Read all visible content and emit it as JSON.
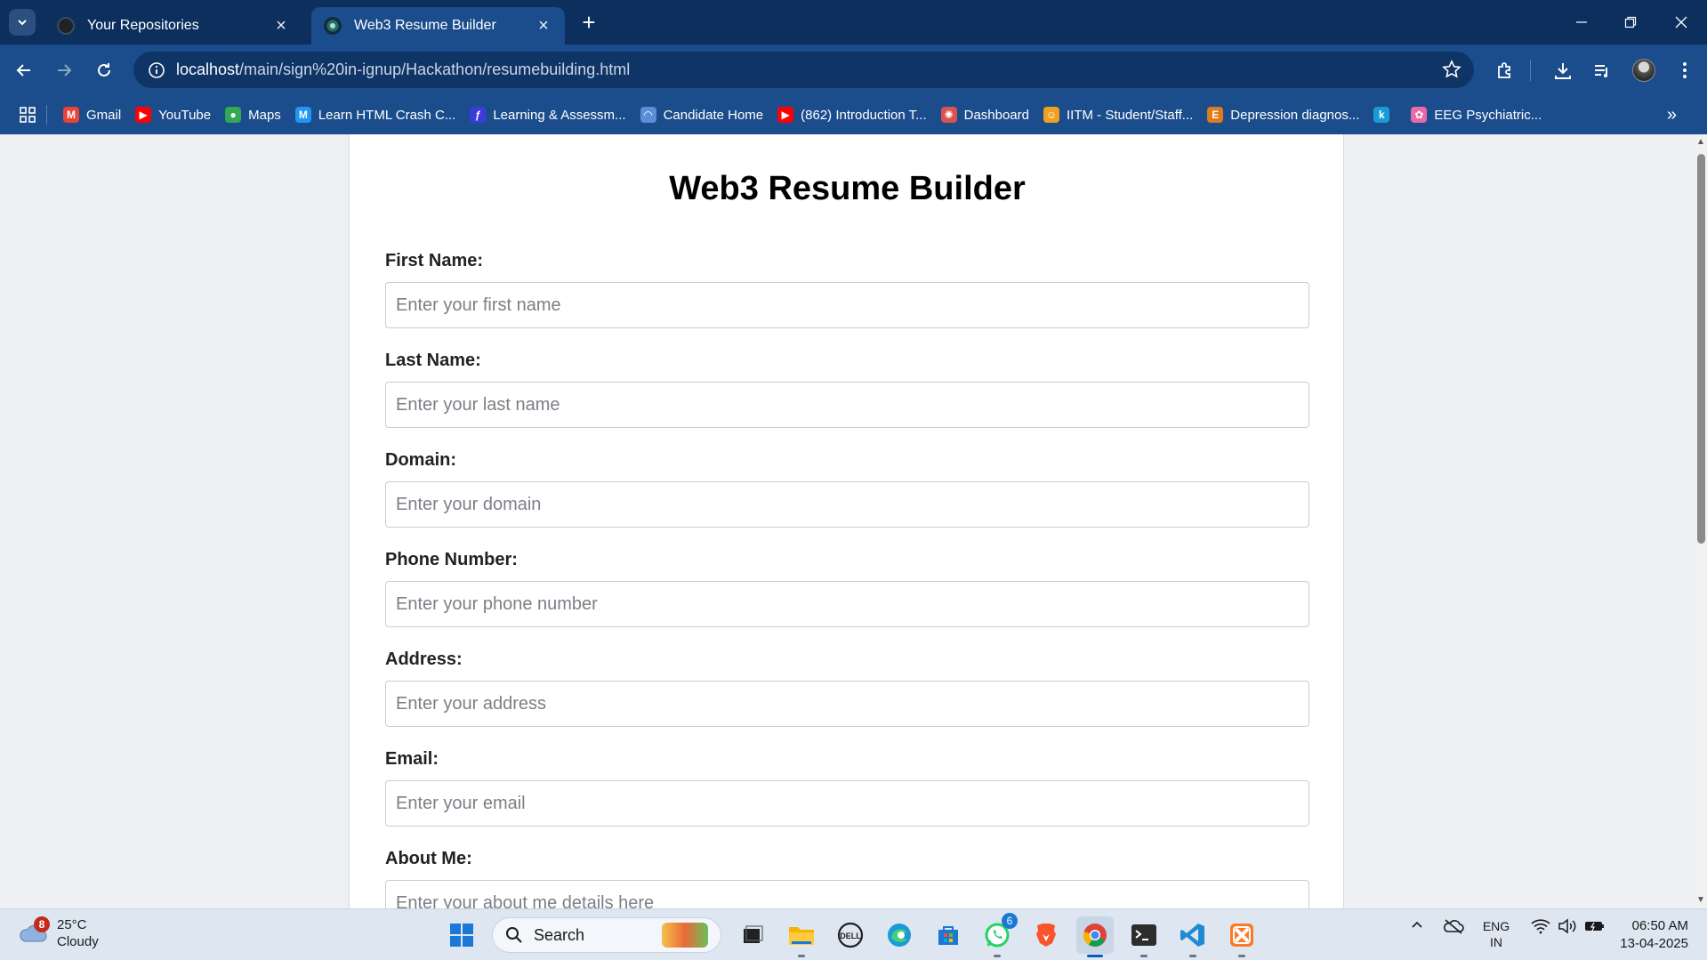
{
  "browser": {
    "tabs": [
      {
        "title": "Your Repositories",
        "active": false
      },
      {
        "title": "Web3 Resume Builder",
        "active": true
      }
    ],
    "url_host": "localhost",
    "url_path": "/main/sign%20in-ignup/Hackathon/resumebuilding.html",
    "bookmarks": [
      {
        "label": "Gmail",
        "icon": "gmail-icon",
        "color": "#ea4335",
        "glyph": "M"
      },
      {
        "label": "YouTube",
        "icon": "youtube-icon",
        "color": "#ff0000",
        "glyph": "▶"
      },
      {
        "label": "Maps",
        "icon": "maps-icon",
        "color": "#34a853",
        "glyph": "●"
      },
      {
        "label": "Learn HTML Crash C...",
        "icon": "m-logo-icon",
        "color": "#2196f3",
        "glyph": "M"
      },
      {
        "label": "Learning & Assessm...",
        "icon": "learning-icon",
        "color": "#3b3bd9",
        "glyph": "ƒ"
      },
      {
        "label": "Candidate Home",
        "icon": "candidate-icon",
        "color": "#5a8fd6",
        "glyph": "◠"
      },
      {
        "label": "(862) Introduction T...",
        "icon": "youtube-icon",
        "color": "#ff0000",
        "glyph": "▶"
      },
      {
        "label": "Dashboard",
        "icon": "dashboard-icon",
        "color": "#d9534f",
        "glyph": "✺"
      },
      {
        "label": "IITM - Student/Staff...",
        "icon": "emoji-icon",
        "color": "#f0a020",
        "glyph": "☺"
      },
      {
        "label": "Depression diagnos...",
        "icon": "e-logo-icon",
        "color": "#e07b1a",
        "glyph": "E"
      },
      {
        "label": "",
        "icon": "k-logo-icon",
        "color": "#1a9bd7",
        "glyph": "k"
      },
      {
        "label": "EEG Psychiatric...",
        "icon": "brain-icon",
        "color": "#e86aa6",
        "glyph": "✿"
      }
    ]
  },
  "page": {
    "heading": "Web3 Resume Builder",
    "fields": [
      {
        "label": "First Name:",
        "placeholder": "Enter your first name",
        "value": ""
      },
      {
        "label": "Last Name:",
        "placeholder": "Enter your last name",
        "value": ""
      },
      {
        "label": "Domain:",
        "placeholder": "Enter your domain",
        "value": ""
      },
      {
        "label": "Phone Number:",
        "placeholder": "Enter your phone number",
        "value": ""
      },
      {
        "label": "Address:",
        "placeholder": "Enter your address",
        "value": ""
      },
      {
        "label": "Email:",
        "placeholder": "Enter your email",
        "value": ""
      },
      {
        "label": "About Me:",
        "placeholder": "Enter your about me details here",
        "value": ""
      }
    ]
  },
  "taskbar": {
    "weather_badge": "8",
    "temperature": "25°C",
    "condition": "Cloudy",
    "search_placeholder": "Search",
    "whatsapp_badge": "6",
    "language": "ENG",
    "region": "IN",
    "time": "06:50 AM",
    "date": "13-04-2025"
  },
  "colors": {
    "tabbar_bg": "#0c2f5e",
    "toolbar_bg": "#1b4d8c",
    "page_bg": "#eef0f3",
    "card_bg": "#ffffff"
  }
}
